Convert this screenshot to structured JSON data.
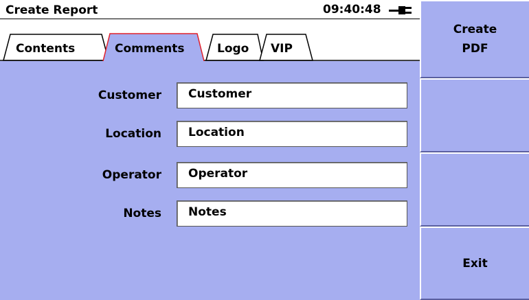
{
  "window": {
    "title": "Create Report",
    "clock": "09:40:48",
    "power_icon": "plug-icon"
  },
  "tabs": [
    {
      "label": "Contents",
      "selected": false
    },
    {
      "label": "Comments",
      "selected": true
    },
    {
      "label": "Logo",
      "selected": false
    },
    {
      "label": "VIP",
      "selected": false
    }
  ],
  "fields": [
    {
      "label": "Customer",
      "value": "Customer"
    },
    {
      "label": "Location",
      "value": "Location"
    },
    {
      "label": "Operator",
      "value": "Operator"
    },
    {
      "label": "Notes",
      "value": "Notes"
    }
  ],
  "softkeys": {
    "create_pdf_line1": "Create",
    "create_pdf_line2": "PDF",
    "blank2": "",
    "blank3": "",
    "exit": "Exit"
  },
  "colors": {
    "background": "#a6aef0",
    "selected_tab_outline": "#e0202a"
  }
}
